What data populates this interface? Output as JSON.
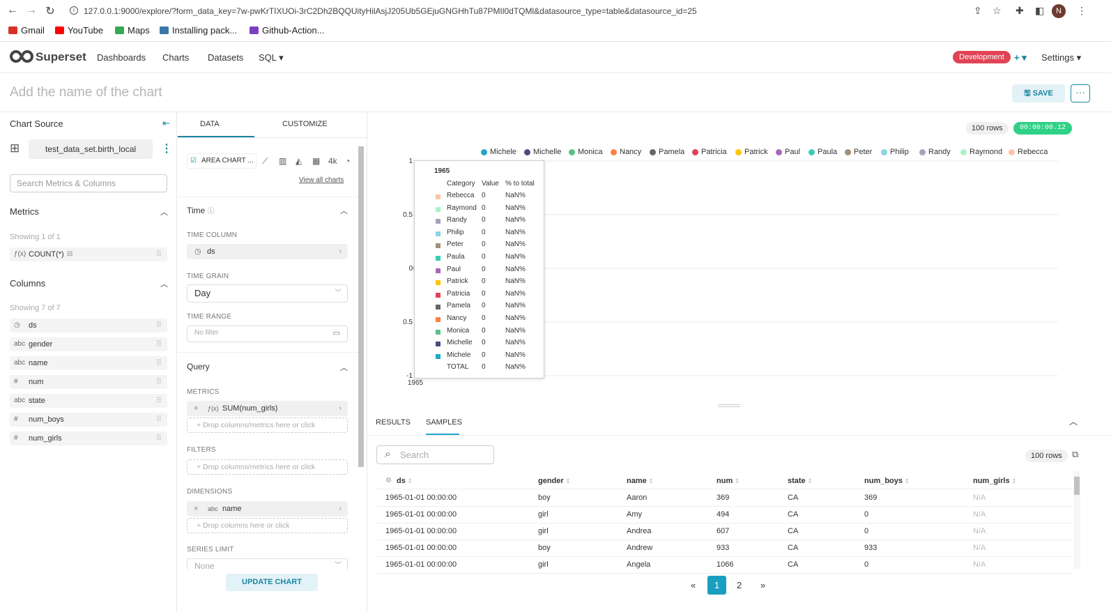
{
  "browser": {
    "url": "127.0.0.1:9000/explore/?form_data_key=7w-pwKrTIXUOi-3rC2Dh2BQQUityHilAsjJ205Ub5GEjuGNGHhTu87PMIl0dTQMl&datasource_type=table&datasource_id=25",
    "bookmarks": [
      {
        "label": "Gmail",
        "color": "#d93025"
      },
      {
        "label": "YouTube",
        "color": "#ff0000"
      },
      {
        "label": "Maps",
        "color": "#34a853"
      },
      {
        "label": "Installing pack...",
        "color": "#3b77a8"
      },
      {
        "label": "Github-Action...",
        "color": "#7d3fc1"
      }
    ],
    "avatar": "N"
  },
  "nav": {
    "brand": "Superset",
    "links": [
      "Dashboards",
      "Charts",
      "Datasets",
      "SQL ▾"
    ],
    "env": "Development",
    "plus": "+ ▾",
    "settings": "Settings ▾"
  },
  "title": {
    "placeholder": "Add the name of the chart",
    "save": "SAVE",
    "more": "···"
  },
  "left": {
    "chart_source": "Chart Source",
    "dataset": "test_data_set.birth_local",
    "search_placeholder": "Search Metrics & Columns",
    "metrics_title": "Metrics",
    "metrics_showing": "Showing 1 of 1",
    "metrics": [
      {
        "type": "ƒ(x)",
        "name": "COUNT(*)"
      }
    ],
    "columns_title": "Columns",
    "columns_showing": "Showing 7 of 7",
    "columns": [
      {
        "type": "◷",
        "name": "ds"
      },
      {
        "type": "abc",
        "name": "gender"
      },
      {
        "type": "abc",
        "name": "name"
      },
      {
        "type": "#",
        "name": "num"
      },
      {
        "type": "abc",
        "name": "state"
      },
      {
        "type": "#",
        "name": "num_boys"
      },
      {
        "type": "#",
        "name": "num_girls"
      }
    ]
  },
  "mid": {
    "tabs": [
      "DATA",
      "CUSTOMIZE"
    ],
    "viz_type": "AREA CHART ...",
    "view_all": "View all charts",
    "time_section": "Time",
    "time_column_label": "TIME COLUMN",
    "time_column": "ds",
    "time_grain_label": "TIME GRAIN",
    "time_grain": "Day",
    "time_range_label": "TIME RANGE",
    "time_range": "No filter",
    "query_section": "Query",
    "metrics_label": "METRICS",
    "metric_value": "SUM(num_girls)",
    "drop_metrics": "+ Drop columns/metrics here or click",
    "filters_label": "FILTERS",
    "drop_filters": "+ Drop columns/metrics here or click",
    "dimensions_label": "DIMENSIONS",
    "dimension_value": "name",
    "drop_columns": "+ Drop columns here or click",
    "series_limit_label": "SERIES LIMIT",
    "series_limit": "None",
    "update": "UPDATE CHART"
  },
  "chart_meta": {
    "rows": "100 rows",
    "timer": "00:00:00.12"
  },
  "chart_data": {
    "type": "area",
    "x": [
      "1965"
    ],
    "ylim": [
      -1,
      1
    ],
    "yticks": [
      "1",
      "0.5",
      "0",
      "0.5",
      "-1"
    ],
    "xticks": [
      "1965"
    ],
    "series": [
      {
        "name": "Michele",
        "color": "#1fa8c9",
        "values": [
          0
        ]
      },
      {
        "name": "Michelle",
        "color": "#454e7c",
        "values": [
          0
        ]
      },
      {
        "name": "Monica",
        "color": "#5ac189",
        "values": [
          0
        ]
      },
      {
        "name": "Nancy",
        "color": "#ff7f44",
        "values": [
          0
        ]
      },
      {
        "name": "Pamela",
        "color": "#666666",
        "values": [
          0
        ]
      },
      {
        "name": "Patricia",
        "color": "#e04355",
        "values": [
          0
        ]
      },
      {
        "name": "Patrick",
        "color": "#fcc700",
        "values": [
          0
        ]
      },
      {
        "name": "Paul",
        "color": "#a868b7",
        "values": [
          0
        ]
      },
      {
        "name": "Paula",
        "color": "#3cccb4",
        "values": [
          0
        ]
      },
      {
        "name": "Peter",
        "color": "#a38f79",
        "values": [
          0
        ]
      },
      {
        "name": "Philip",
        "color": "#8fd3e4",
        "values": [
          0
        ]
      },
      {
        "name": "Randy",
        "color": "#a1a6bd",
        "values": [
          0
        ]
      },
      {
        "name": "Raymond",
        "color": "#acf0c9",
        "values": [
          0
        ]
      },
      {
        "name": "Rebecca",
        "color": "#fdc4a8",
        "values": [
          0
        ]
      }
    ]
  },
  "tooltip": {
    "title": "1965",
    "headers": [
      "Category",
      "Value",
      "% to total"
    ],
    "rows": [
      {
        "name": "Rebecca",
        "value": "0",
        "pct": "NaN%",
        "color": "#fdc4a8"
      },
      {
        "name": "Raymond",
        "value": "0",
        "pct": "NaN%",
        "color": "#acf0c9"
      },
      {
        "name": "Randy",
        "value": "0",
        "pct": "NaN%",
        "color": "#a1a6bd"
      },
      {
        "name": "Philip",
        "value": "0",
        "pct": "NaN%",
        "color": "#8fd3e4"
      },
      {
        "name": "Peter",
        "value": "0",
        "pct": "NaN%",
        "color": "#a38f79"
      },
      {
        "name": "Paula",
        "value": "0",
        "pct": "NaN%",
        "color": "#3cccb4"
      },
      {
        "name": "Paul",
        "value": "0",
        "pct": "NaN%",
        "color": "#a868b7"
      },
      {
        "name": "Patrick",
        "value": "0",
        "pct": "NaN%",
        "color": "#fcc700"
      },
      {
        "name": "Patricia",
        "value": "0",
        "pct": "NaN%",
        "color": "#e04355"
      },
      {
        "name": "Pamela",
        "value": "0",
        "pct": "NaN%",
        "color": "#666666"
      },
      {
        "name": "Nancy",
        "value": "0",
        "pct": "NaN%",
        "color": "#ff7f44"
      },
      {
        "name": "Monica",
        "value": "0",
        "pct": "NaN%",
        "color": "#5ac189"
      },
      {
        "name": "Michelle",
        "value": "0",
        "pct": "NaN%",
        "color": "#454e7c"
      },
      {
        "name": "Michele",
        "value": "0",
        "pct": "NaN%",
        "color": "#1fa8c9"
      },
      {
        "name": "TOTAL",
        "value": "0",
        "pct": "NaN%",
        "color": ""
      }
    ]
  },
  "results": {
    "tabs": [
      "RESULTS",
      "SAMPLES"
    ],
    "search_placeholder": "Search",
    "rows_label": "100 rows",
    "columns": [
      "ds",
      "gender",
      "name",
      "num",
      "state",
      "num_boys",
      "num_girls"
    ],
    "rows": [
      [
        "1965-01-01 00:00:00",
        "boy",
        "Aaron",
        "369",
        "CA",
        "369",
        "N/A"
      ],
      [
        "1965-01-01 00:00:00",
        "girl",
        "Amy",
        "494",
        "CA",
        "0",
        "N/A"
      ],
      [
        "1965-01-01 00:00:00",
        "girl",
        "Andrea",
        "607",
        "CA",
        "0",
        "N/A"
      ],
      [
        "1965-01-01 00:00:00",
        "boy",
        "Andrew",
        "933",
        "CA",
        "933",
        "N/A"
      ],
      [
        "1965-01-01 00:00:00",
        "girl",
        "Angela",
        "1066",
        "CA",
        "0",
        "N/A"
      ]
    ],
    "pages": [
      "«",
      "1",
      "2",
      "»"
    ]
  }
}
